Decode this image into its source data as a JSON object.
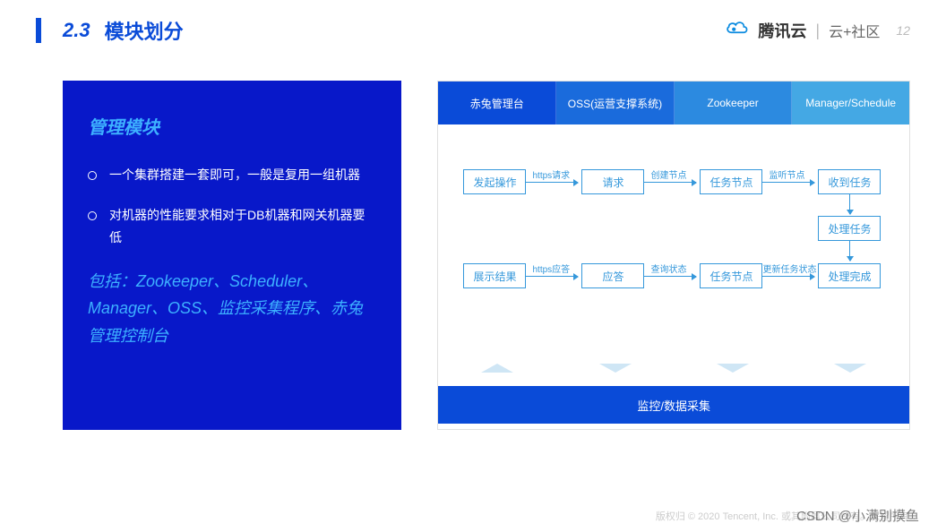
{
  "header": {
    "section_num": "2.3",
    "section_title": "模块划分",
    "brand1": "腾讯云",
    "brand2": "云+社区",
    "page_num": "12"
  },
  "left_panel": {
    "title": "管理模块",
    "bullets": [
      "一个集群搭建一套即可，一般是复用一组机器",
      "对机器的性能要求相对于DB机器和网关机器要低"
    ],
    "includes": "包括：Zookeeper、Scheduler、Manager、OSS、监控采集程序、赤兔管理控制台"
  },
  "diagram": {
    "columns": [
      "赤兔管理台",
      "OSS(运营支撑系统)",
      "Zookeeper",
      "Manager/Schedule"
    ],
    "row1": {
      "b1": "发起操作",
      "a1": "https请求",
      "b2": "请求",
      "a2": "创建节点",
      "b3": "任务节点",
      "a3": "监听节点",
      "b4": "收到任务"
    },
    "mid": {
      "b5": "处理任务"
    },
    "row2": {
      "b1": "展示结果",
      "a1": "https应答",
      "b2": "应答",
      "a2": "查询状态",
      "b3": "任务节点",
      "a3": "更新任务状态",
      "b4": "处理完成"
    },
    "bottom_bar": "监控/数据采集"
  },
  "footer": {
    "copyright": "版权归 © 2020 Tencent, Inc. 或其附属公司所有。保留所有…",
    "watermark": "CSDN @小满别摸鱼"
  }
}
